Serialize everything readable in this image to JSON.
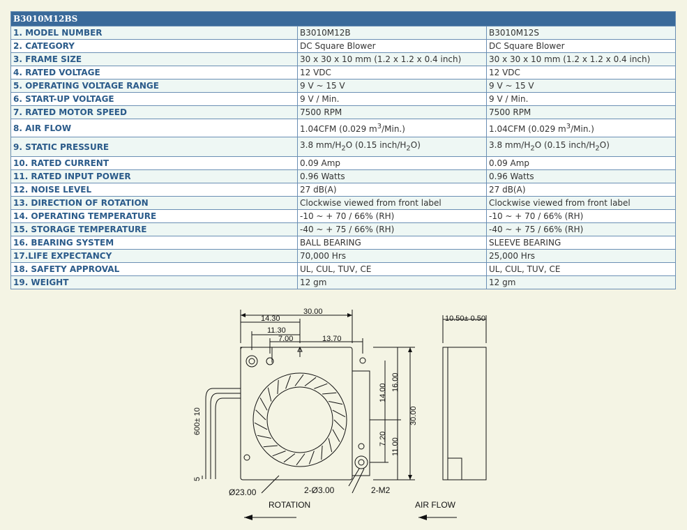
{
  "table": {
    "title": "B3010M12BS",
    "rows": [
      {
        "label": "1. MODEL NUMBER",
        "a": "B3010M12B",
        "b": "B3010M12S"
      },
      {
        "label": "2. CATEGORY",
        "a": "DC Square Blower",
        "b": "DC Square Blower"
      },
      {
        "label": "3. FRAME SIZE",
        "a": "30 x 30 x 10 mm (1.2 x 1.2 x 0.4 inch)",
        "b": "30 x 30 x 10 mm (1.2 x 1.2 x 0.4 inch)"
      },
      {
        "label": "4. RATED VOLTAGE",
        "a": "12 VDC",
        "b": "12 VDC"
      },
      {
        "label": "5. OPERATING VOLTAGE RANGE",
        "a": "9 V ~ 15 V",
        "b": "9 V ~ 15 V"
      },
      {
        "label": "6. START-UP VOLTAGE",
        "a": "9 V / Min.",
        "b": "9 V / Min."
      },
      {
        "label": "7. RATED MOTOR SPEED",
        "a": "7500 RPM",
        "b": "7500 RPM"
      },
      {
        "label": "8. AIR FLOW",
        "a_pre": "1.04CFM (0.029 m",
        "a_sup": "3",
        "a_post": "/Min.)",
        "b_pre": "1.04CFM (0.029 m",
        "b_sup": "3",
        "b_post": "/Min.)"
      },
      {
        "label": "9. STATIC PRESSURE",
        "a_pre": "3.8 mm/H",
        "a_sub": "2",
        "a_mid": "O (0.15 inch/H",
        "a_sub2": "2",
        "a_post": "O)",
        "b_pre": "3.8 mm/H",
        "b_sub": "2",
        "b_mid": "O (0.15 inch/H",
        "b_sub2": "2",
        "b_post": "O)"
      },
      {
        "label": "10. RATED CURRENT",
        "a": "0.09 Amp",
        "b": "0.09 Amp"
      },
      {
        "label": "11. RATED INPUT POWER",
        "a": "0.96 Watts",
        "b": "0.96 Watts"
      },
      {
        "label": "12. NOISE LEVEL",
        "a": "27 dB(A)",
        "b": "27 dB(A)"
      },
      {
        "label": "13. DIRECTION OF ROTATION",
        "a": "Clockwise viewed from front label",
        "b": "Clockwise viewed from front label"
      },
      {
        "label": "14. OPERATING TEMPERATURE",
        "a": "-10 ~ + 70 / 66% (RH)",
        "b": "-10 ~ + 70 / 66% (RH)"
      },
      {
        "label": "15. STORAGE TEMPERATURE",
        "a": "-40 ~ + 75 / 66% (RH)",
        "b": "-40 ~ + 75 / 66% (RH)"
      },
      {
        "label": "16. BEARING SYSTEM",
        "a": "BALL BEARING",
        "b": "SLEEVE BEARING"
      },
      {
        "label": "17.LIFE EXPECTANCY",
        "a": "70,000 Hrs",
        "b": "25,000 Hrs"
      },
      {
        "label": "18. SAFETY APPROVAL",
        "a": "UL, CUL, TUV, CE",
        "b": "UL, CUL, TUV, CE"
      },
      {
        "label": "19. WEIGHT",
        "a": "12 gm",
        "b": "12 gm"
      }
    ]
  },
  "drawing": {
    "dims": {
      "width_total": "30.00",
      "d_14_30": "14.30",
      "d_11_30": "11.30",
      "d_7_00": "7.00",
      "d_13_70": "13.70",
      "d_14_00": "14.00",
      "d_16_00": "16.00",
      "d_30_00_v": "30.00",
      "d_7_20": "7.20",
      "d_11_00": "11.00",
      "d_600": "600± 10",
      "d_5": "5",
      "dia_23": "Ø23.00",
      "holes": "2-Ø3.00",
      "m2": "2-M2",
      "side_depth": "10.50± 0.50"
    },
    "labels": {
      "rotation": "ROTATION",
      "air_flow": "AIR FLOW"
    }
  }
}
